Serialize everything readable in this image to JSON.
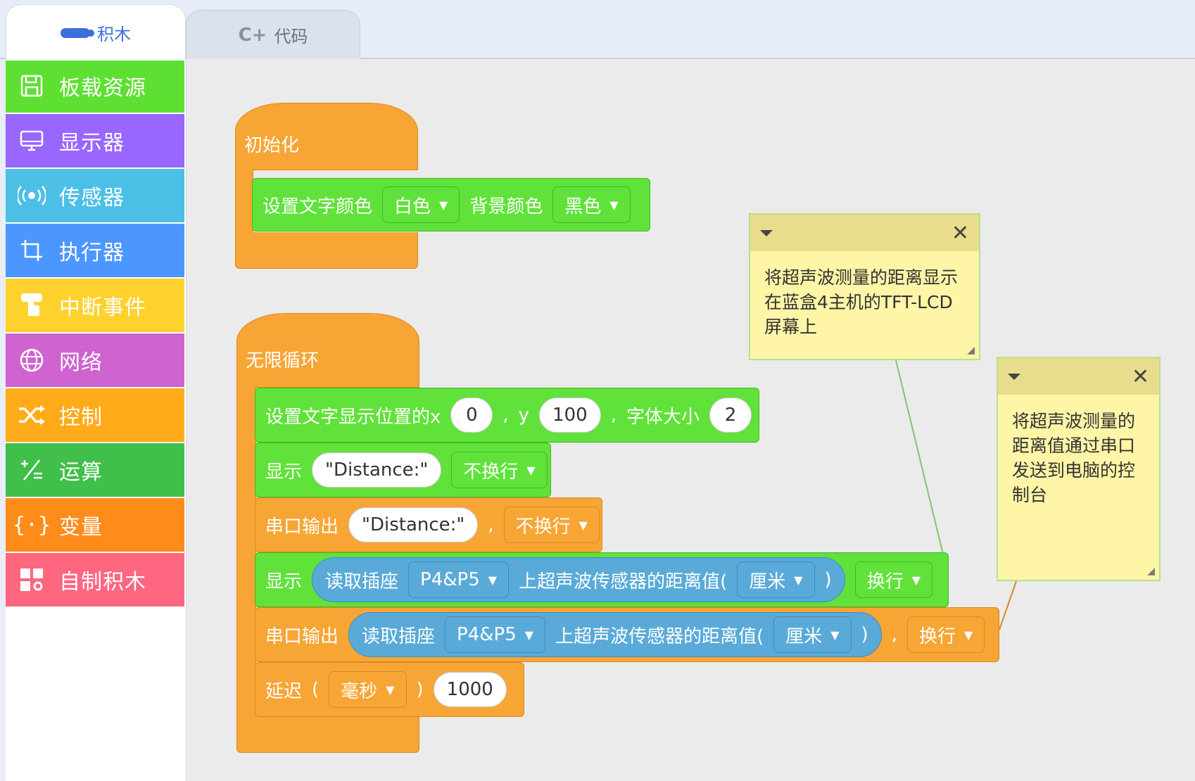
{
  "tabs": {
    "blocks_label": "积木",
    "code_label": "代码"
  },
  "sidebar": {
    "items": [
      {
        "label": "板载资源",
        "icon": "floppy-disk-icon",
        "color": "#5ee033"
      },
      {
        "label": "显示器",
        "icon": "monitor-icon",
        "color": "#9966ff"
      },
      {
        "label": "传感器",
        "icon": "signal-icon",
        "color": "#4cbfe6"
      },
      {
        "label": "执行器",
        "icon": "crop-icon",
        "color": "#4c97ff"
      },
      {
        "label": "中断事件",
        "icon": "hand-icon",
        "color": "#ffd12d"
      },
      {
        "label": "网络",
        "icon": "globe-icon",
        "color": "#cf63cf"
      },
      {
        "label": "控制",
        "icon": "shuffle-icon",
        "color": "#ffab19"
      },
      {
        "label": "运算",
        "icon": "math-icon",
        "color": "#40bf4a"
      },
      {
        "label": "变量",
        "icon": "braces-icon",
        "color": "#ff8c1a"
      },
      {
        "label": "自制积木",
        "icon": "grid-icon",
        "color": "#ff6680"
      }
    ]
  },
  "init_block": {
    "hat_label": "初始化",
    "set_color_label": "设置文字颜色",
    "text_color": "白色",
    "bg_label": "背景颜色",
    "bg_color": "黑色"
  },
  "loop_block": {
    "hat_label": "无限循环",
    "set_pos": {
      "label": "设置文字显示位置的x",
      "x": "0",
      "comma1": ",",
      "y_label": "y",
      "y": "100",
      "comma2": ",",
      "size_label": "字体大小",
      "size": "2"
    },
    "display1": {
      "label": "显示",
      "text": "\"Distance:\"",
      "newline": "不换行"
    },
    "serial1": {
      "label": "串口输出",
      "text": "\"Distance:\"",
      "comma": ",",
      "newline": "不换行"
    },
    "display2": {
      "label": "显示",
      "read_label": "读取插座",
      "port": "P4&P5",
      "sensor_label": "上超声波传感器的距离值(",
      "unit": "厘米",
      "close": ")",
      "newline": "换行"
    },
    "serial2": {
      "label": "串口输出",
      "read_label": "读取插座",
      "port": "P4&P5",
      "sensor_label": "上超声波传感器的距离值(",
      "unit": "厘米",
      "close": ")",
      "comma": ",",
      "newline": "换行"
    },
    "delay": {
      "label": "延迟",
      "open": "(",
      "unit": "毫秒",
      "close": ")",
      "value": "1000"
    }
  },
  "comments": [
    {
      "text": "将超声波测量的距离显示在蓝盒4主机的TFT-LCD屏幕上"
    },
    {
      "text": "将超声波测量的距离值通过串口发送到电脑的控制台"
    }
  ]
}
